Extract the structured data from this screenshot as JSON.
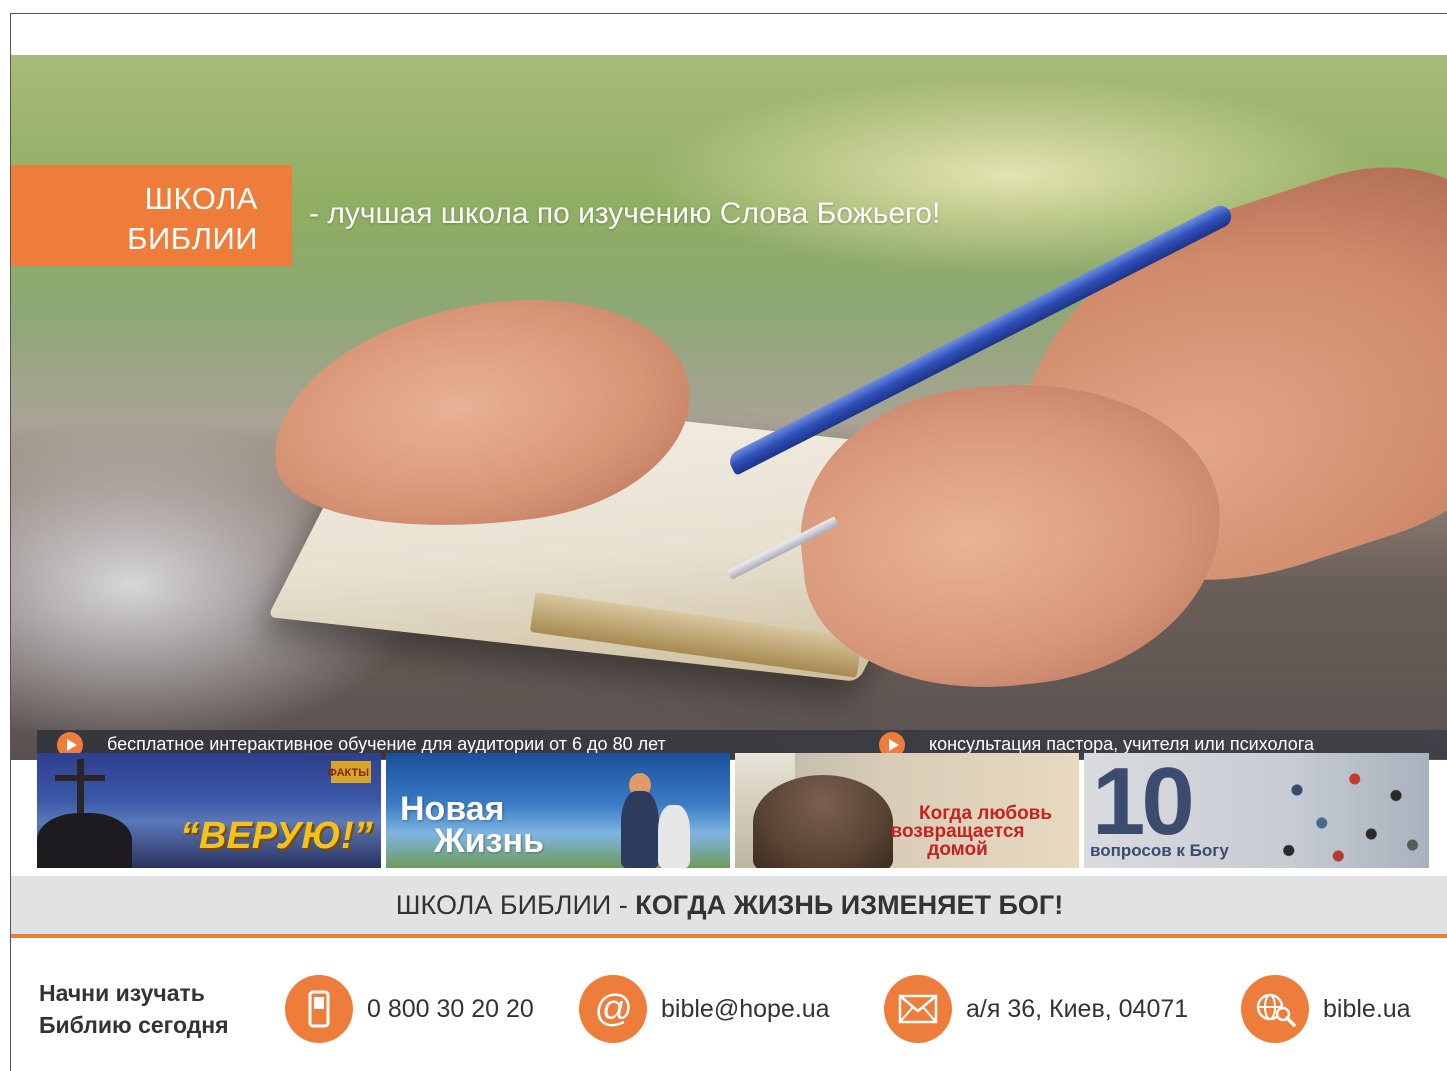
{
  "brand": {
    "line1": "ШКОЛА",
    "line2": "БИБЛИИ"
  },
  "tagline": "- лучшая школа по изучению Слова Божьего!",
  "features": [
    "бесплатное интерактивное обучение для аудитории от 6 до 80 лет",
    "консультация пастора, учителя или психолога"
  ],
  "programs": {
    "veruyu": {
      "logo": "ФАКТЫ",
      "title": "“ВЕРУЮ!”"
    },
    "novaya": {
      "line1": "Новая",
      "line2": "Жизнь"
    },
    "lyubov": {
      "line1": "Когда любовь",
      "line2": "возвращается",
      "line3": "домой"
    },
    "voprosy": {
      "number": "10",
      "subtitle": "вопросов к Богу"
    }
  },
  "slogan": {
    "part1": "ШКОЛА БИБЛИИ - ",
    "part2": "КОГДА ЖИЗНЬ ИЗМЕНЯЕТ БОГ!"
  },
  "contacts": {
    "start_line1": "Начни изучать",
    "start_line2": "Библию сегодня",
    "phone": "0 800 30 20 20",
    "email": "bible@hope.ua",
    "address": "а/я 36, Киев, 04071",
    "website": "bible.ua"
  },
  "icons": {
    "phone": "mobile-phone-icon",
    "email": "at-sign-icon",
    "address": "envelope-icon",
    "website": "globe-search-icon"
  },
  "colors": {
    "accent": "#ee7c3a",
    "slogan_bg": "#e1e2e4",
    "text": "#333333"
  }
}
